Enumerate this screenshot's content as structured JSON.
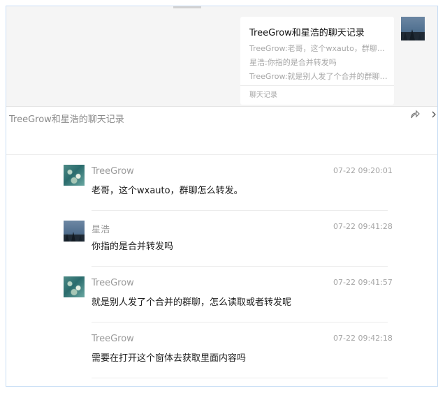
{
  "chat_bg": {
    "merged_card": {
      "title": "TreeGrow和星浩的聊天记录",
      "lines": [
        "TreeGrow:老哥，这个wxauto，群聊怎么转发。",
        "星浩:你指的是合并转发吗",
        "TreeGrow:就是别人发了个合并的群聊，怎么读取或者转发呢"
      ],
      "footer": "聊天记录"
    }
  },
  "record": {
    "title": "TreeGrow和星浩的聊天记录",
    "icons": [
      "share-icon",
      "chevron-right-icon"
    ]
  },
  "messages": [
    {
      "name": "TreeGrow",
      "time": "07-22 09:20:01",
      "text": "老哥，这个wxauto，群聊怎么转发。",
      "avatar": "tree"
    },
    {
      "name": "星浩",
      "time": "07-22 09:41:28",
      "text": "你指的是合并转发吗",
      "avatar": "star"
    },
    {
      "name": "TreeGrow",
      "time": "07-22 09:41:57",
      "text": "就是别人发了个合并的群聊，怎么读取或者转发呢",
      "avatar": "tree"
    },
    {
      "name": "TreeGrow",
      "time": "07-22 09:42:18",
      "text": "需要在打开这个窗体去获取里面内容吗",
      "avatar": "none"
    }
  ]
}
